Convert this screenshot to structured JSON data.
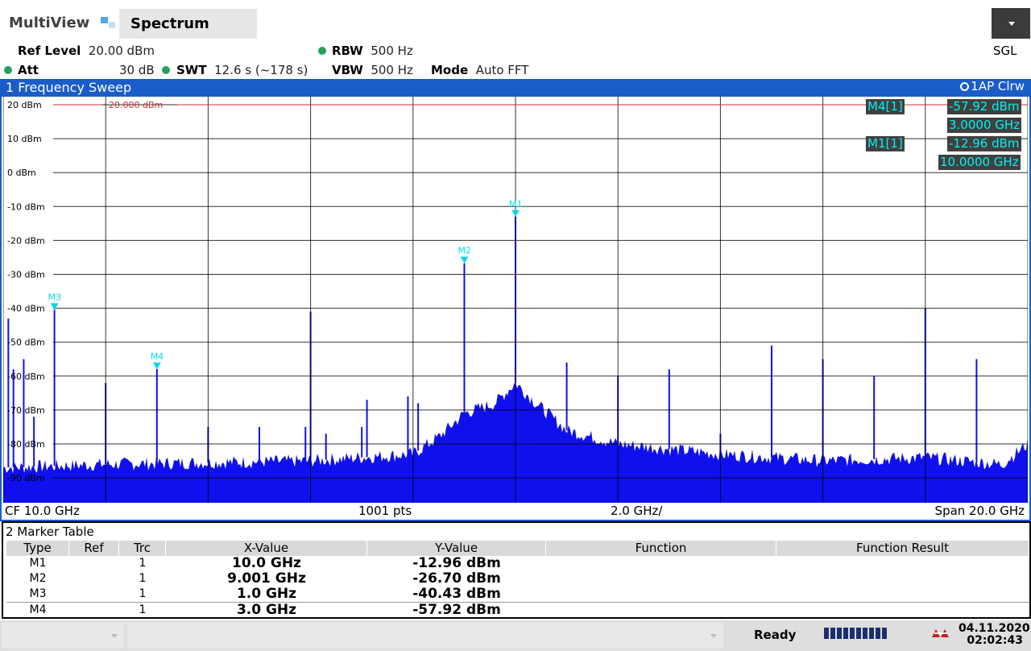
{
  "app": {
    "title": "MultiView",
    "tab_label": "Spectrum",
    "sweep_mode": "SGL"
  },
  "settings": {
    "ref_level_label": "Ref Level",
    "ref_level_value": "20.00 dBm",
    "att_label": "Att",
    "att_value": "30 dB",
    "swt_label": "SWT",
    "swt_value": "12.6 s (~178 s)",
    "rbw_label": "RBW",
    "rbw_value": "500 Hz",
    "vbw_label": "VBW",
    "vbw_value": "500 Hz",
    "mode_label": "Mode",
    "mode_value": "Auto FFT"
  },
  "sweep_window": {
    "title": "1 Frequency Sweep",
    "trace_info": "1AP Clrw",
    "ref_line_label": "20.000 dBm",
    "footer": {
      "cf": "CF 10.0 GHz",
      "points": "1001 pts",
      "div": "2.0 GHz/",
      "span": "Span 20.0 GHz"
    }
  },
  "marker_info": [
    {
      "name": "M4[1]",
      "level": "-57.92 dBm",
      "freq": "3.0000 GHz"
    },
    {
      "name": "M1[1]",
      "level": "-12.96 dBm",
      "freq": "10.0000 GHz"
    }
  ],
  "marker_table": {
    "title": "2 Marker Table",
    "columns": [
      "Type",
      "Ref",
      "Trc",
      "X-Value",
      "Y-Value",
      "Function",
      "Function Result"
    ],
    "rows": [
      {
        "type": "M1",
        "ref": "",
        "trc": "1",
        "x": "10.0 GHz",
        "y": "-12.96 dBm",
        "function": "",
        "result": ""
      },
      {
        "type": "M2",
        "ref": "",
        "trc": "1",
        "x": "9.001 GHz",
        "y": "-26.70 dBm",
        "function": "",
        "result": ""
      },
      {
        "type": "M3",
        "ref": "",
        "trc": "1",
        "x": "1.0 GHz",
        "y": "-40.43 dBm",
        "function": "",
        "result": ""
      },
      {
        "type": "M4",
        "ref": "",
        "trc": "1",
        "x": "3.0 GHz",
        "y": "-57.92 dBm",
        "function": "",
        "result": ""
      }
    ]
  },
  "status": {
    "ready": "Ready",
    "date": "04.11.2020",
    "time": "02:02:43"
  },
  "colors": {
    "trace": "#1010ee",
    "marker": "#00d8e8",
    "title_bar": "#1a5cc8",
    "ref_line": "#d03030"
  },
  "chart_data": {
    "type": "line",
    "x_unit": "GHz",
    "y_unit": "dBm",
    "xlim": [
      0,
      20
    ],
    "ylim": [
      -100,
      20
    ],
    "y_ticks": [
      "20 dBm",
      "10 dBm",
      "0 dBm",
      "-10 dBm",
      "-20 dBm",
      "-30 dBm",
      "-40 dBm",
      "-50 dBm",
      "-60 dBm",
      "-70 dBm",
      "-80 dBm",
      "-90 dBm"
    ],
    "y_tick_values": [
      20,
      10,
      0,
      -10,
      -20,
      -30,
      -40,
      -50,
      -60,
      -70,
      -80,
      -90
    ],
    "grid": true,
    "reference_level": 20,
    "markers": [
      {
        "name": "M1",
        "x": 10.0,
        "y": -12.96
      },
      {
        "name": "M2",
        "x": 9.001,
        "y": -26.7
      },
      {
        "name": "M3",
        "x": 1.0,
        "y": -40.43
      },
      {
        "name": "M4",
        "x": 3.0,
        "y": -57.92
      }
    ],
    "spurs": [
      {
        "x": 0.1,
        "y": -43
      },
      {
        "x": 0.2,
        "y": -58
      },
      {
        "x": 0.4,
        "y": -55
      },
      {
        "x": 0.6,
        "y": -72
      },
      {
        "x": 1.0,
        "y": -40.43
      },
      {
        "x": 2.0,
        "y": -62
      },
      {
        "x": 3.0,
        "y": -57.92
      },
      {
        "x": 4.0,
        "y": -75
      },
      {
        "x": 5.0,
        "y": -75
      },
      {
        "x": 5.9,
        "y": -75
      },
      {
        "x": 6.0,
        "y": -41
      },
      {
        "x": 6.3,
        "y": -77
      },
      {
        "x": 7.0,
        "y": -75
      },
      {
        "x": 7.1,
        "y": -67
      },
      {
        "x": 7.9,
        "y": -66
      },
      {
        "x": 8.1,
        "y": -68
      },
      {
        "x": 9.001,
        "y": -26.7
      },
      {
        "x": 10.0,
        "y": -12.96
      },
      {
        "x": 11.0,
        "y": -56
      },
      {
        "x": 12.0,
        "y": -60
      },
      {
        "x": 13.0,
        "y": -58
      },
      {
        "x": 14.0,
        "y": -77
      },
      {
        "x": 15.0,
        "y": -51
      },
      {
        "x": 16.0,
        "y": -55
      },
      {
        "x": 17.0,
        "y": -60
      },
      {
        "x": 18.0,
        "y": -40
      },
      {
        "x": 19.0,
        "y": -55
      }
    ],
    "noise_floor": [
      {
        "x": 0.0,
        "y": -87
      },
      {
        "x": 2.0,
        "y": -86
      },
      {
        "x": 6.0,
        "y": -85
      },
      {
        "x": 8.0,
        "y": -83
      },
      {
        "x": 8.5,
        "y": -78
      },
      {
        "x": 9.0,
        "y": -71
      },
      {
        "x": 9.6,
        "y": -68
      },
      {
        "x": 10.0,
        "y": -62
      },
      {
        "x": 10.4,
        "y": -68
      },
      {
        "x": 11.0,
        "y": -76
      },
      {
        "x": 12.0,
        "y": -80
      },
      {
        "x": 14.0,
        "y": -83
      },
      {
        "x": 16.0,
        "y": -85
      },
      {
        "x": 18.0,
        "y": -84
      },
      {
        "x": 19.5,
        "y": -86
      },
      {
        "x": 20.0,
        "y": -80
      }
    ]
  }
}
